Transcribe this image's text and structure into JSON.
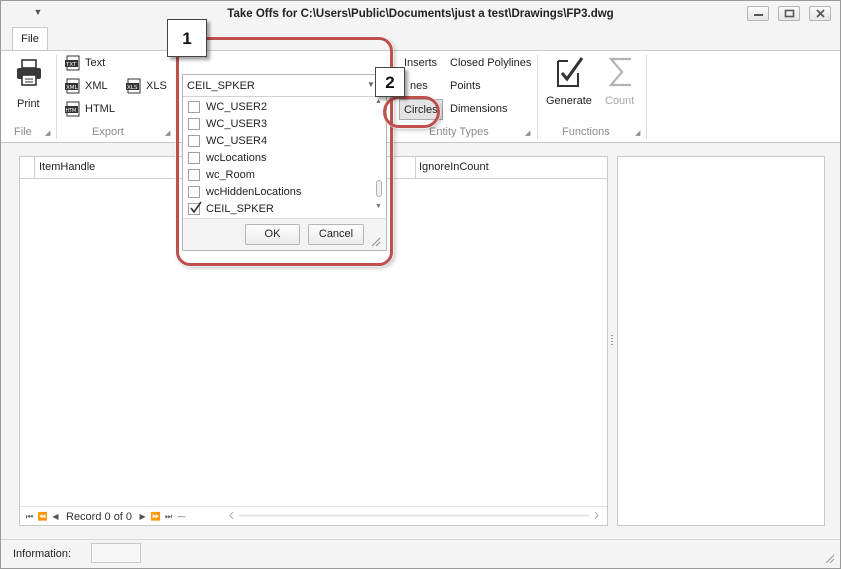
{
  "window": {
    "title": "Take Offs for C:\\Users\\Public\\Documents\\just a test\\Drawings\\FP3.dwg",
    "qat_icon": "dropdown-arrow-icon",
    "controls": [
      "minimize-icon",
      "maximize-icon",
      "close-icon"
    ]
  },
  "ribbon": {
    "tab_file": "File",
    "groups": {
      "file": {
        "label": "File",
        "print_label": "Print",
        "print_icon": "printer-icon"
      },
      "export": {
        "label": "Export",
        "text": "Text",
        "xml": "XML",
        "xls": "XLS",
        "html": "HTML"
      },
      "entity_types": {
        "label": "Entity Types",
        "inserts": "Inserts",
        "closed_polylines": "Closed Polylines",
        "lines_partial": "nes",
        "points": "Points",
        "circles": "Circles",
        "dimensions": "Dimensions"
      },
      "functions": {
        "label": "Functions",
        "generate": "Generate",
        "count": "Count",
        "generate_icon": "checklist-icon",
        "count_icon": "sigma-icon"
      }
    }
  },
  "grid": {
    "columns": [
      "ItemHandle",
      "IgnoreInCount"
    ],
    "footer": {
      "record_text": "Record 0 of 0"
    }
  },
  "status": {
    "info_label": "Information:"
  },
  "popup": {
    "combo_value": "CEIL_SPKER",
    "items": [
      {
        "label": "WC_USER2",
        "checked": false
      },
      {
        "label": "WC_USER3",
        "checked": false
      },
      {
        "label": "WC_USER4",
        "checked": false
      },
      {
        "label": "wcLocations",
        "checked": false
      },
      {
        "label": "wc_Room",
        "checked": false
      },
      {
        "label": "wcHiddenLocations",
        "checked": false
      },
      {
        "label": "CEIL_SPKER",
        "checked": true
      }
    ],
    "ok": "OK",
    "cancel": "Cancel"
  },
  "callouts": {
    "one": "1",
    "two": "2",
    "color": "#c0504d"
  }
}
